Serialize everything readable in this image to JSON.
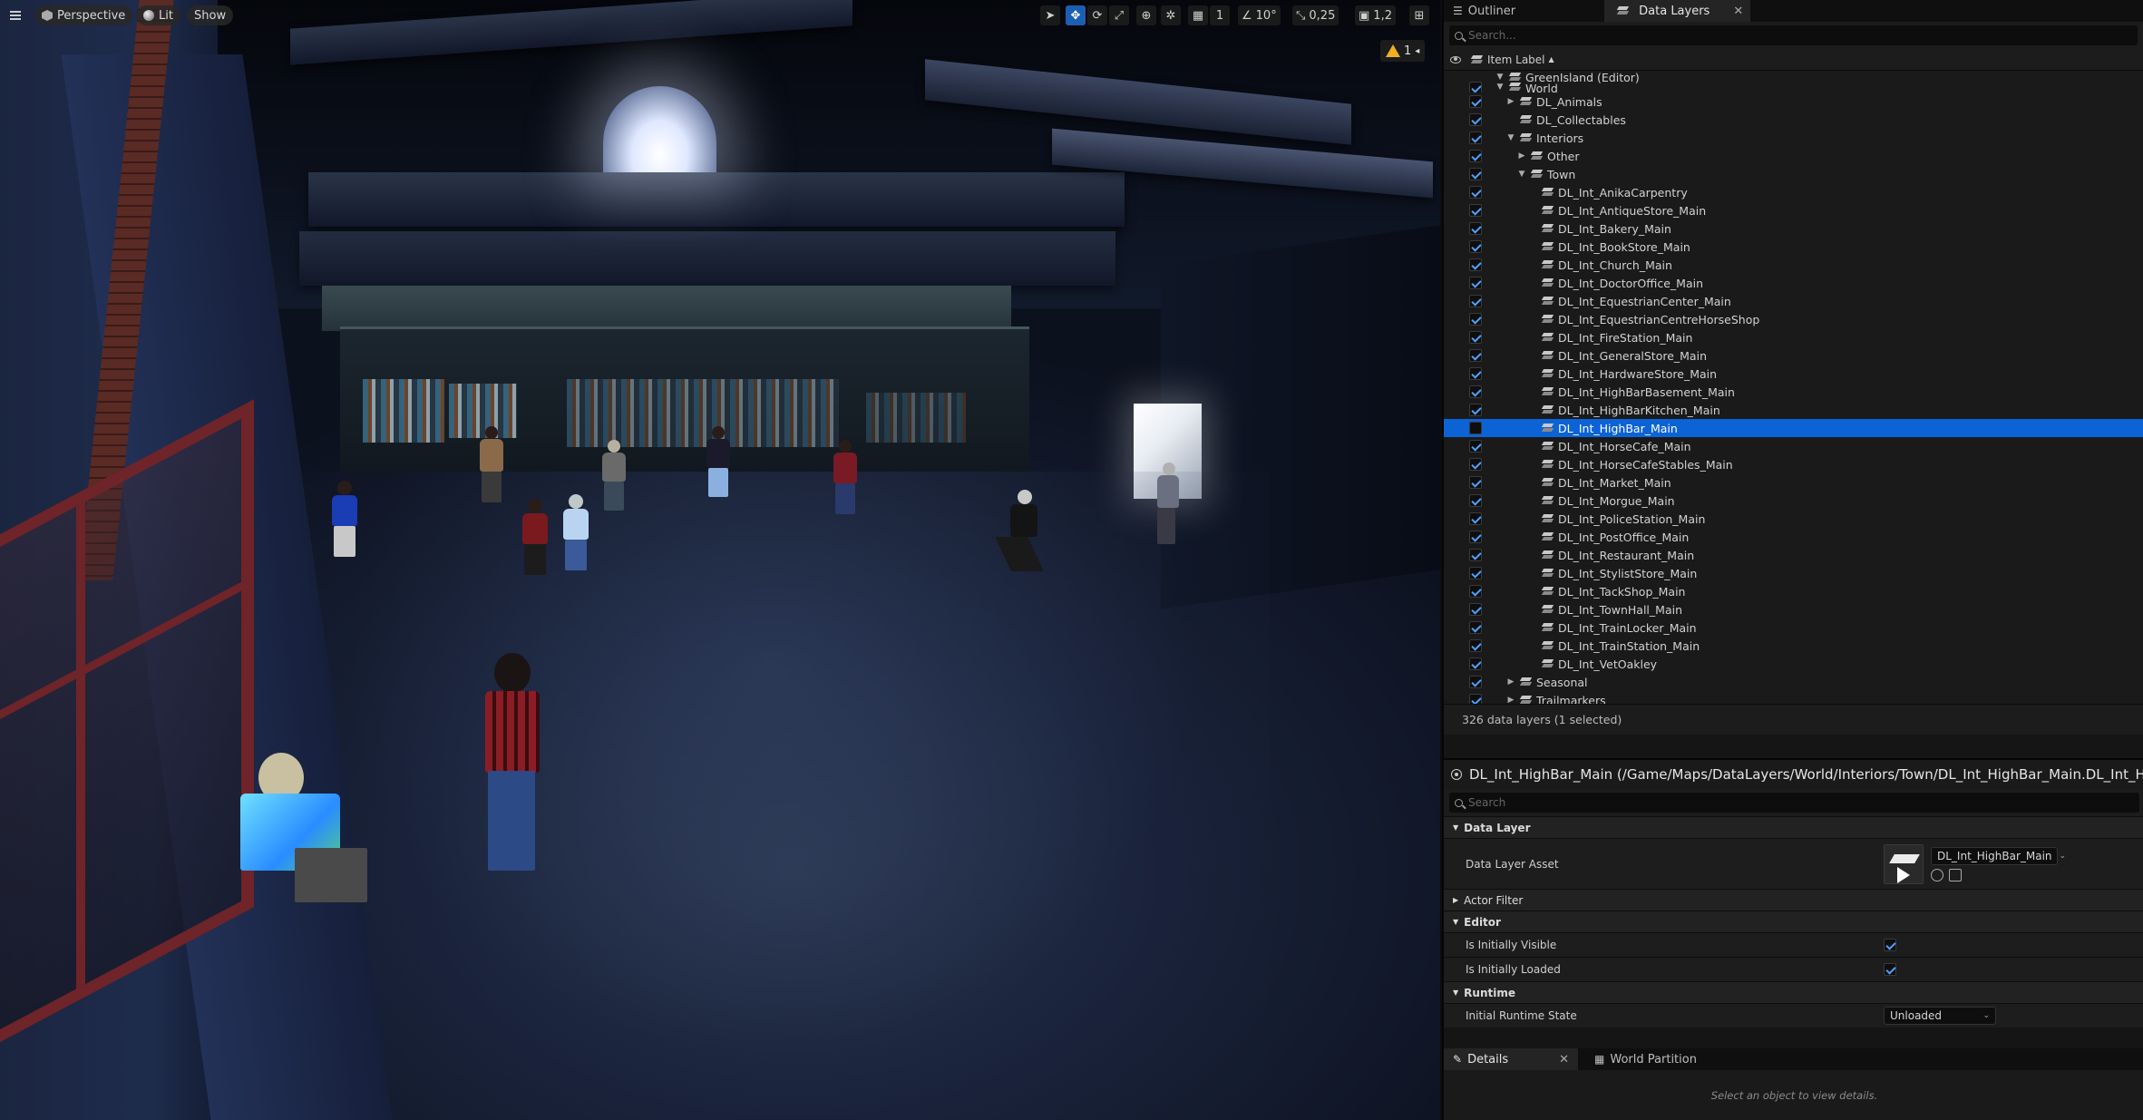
{
  "viewport": {
    "menu_icon": "hamburger-icon",
    "perspective_label": "Perspective",
    "lit_label": "Lit",
    "show_label": "Show",
    "grid_snap_value": "1",
    "rotation_snap_value": "10°",
    "scale_snap_value": "0,25",
    "camera_speed_value": "1,2",
    "warning_count": "1"
  },
  "outliner_panel": {
    "tabs": [
      {
        "label": "Outliner",
        "active": false
      },
      {
        "label": "Data Layers",
        "active": true
      }
    ],
    "close_glyph": "✕",
    "search_placeholder": "Search...",
    "column_label": "Item Label",
    "sort_glyph": "▲",
    "tree": [
      {
        "label": "GreenIsland (Editor)",
        "indent": 2,
        "expander": "▼",
        "check": "none",
        "icon": "world-icon"
      },
      {
        "label": "World",
        "indent": 2,
        "expander": "▼",
        "check": "on",
        "icon": "data-layer-icon"
      },
      {
        "label": "DL_Animals",
        "indent": 3,
        "expander": "▶",
        "check": "on",
        "icon": "data-layer-icon"
      },
      {
        "label": "DL_Collectables",
        "indent": 3,
        "expander": "",
        "check": "on",
        "icon": "data-layer-icon"
      },
      {
        "label": "Interiors",
        "indent": 3,
        "expander": "▼",
        "check": "on",
        "icon": "data-layer-icon"
      },
      {
        "label": "Other",
        "indent": 4,
        "expander": "▶",
        "check": "on",
        "icon": "data-layer-icon"
      },
      {
        "label": "Town",
        "indent": 4,
        "expander": "▼",
        "check": "on",
        "icon": "data-layer-icon"
      },
      {
        "label": "DL_Int_AnikaCarpentry",
        "indent": 5,
        "expander": "",
        "check": "on",
        "icon": "data-layer-icon"
      },
      {
        "label": "DL_Int_AntiqueStore_Main",
        "indent": 5,
        "expander": "",
        "check": "on",
        "icon": "data-layer-icon"
      },
      {
        "label": "DL_Int_Bakery_Main",
        "indent": 5,
        "expander": "",
        "check": "on",
        "icon": "data-layer-icon"
      },
      {
        "label": "DL_Int_BookStore_Main",
        "indent": 5,
        "expander": "",
        "check": "on",
        "icon": "data-layer-icon"
      },
      {
        "label": "DL_Int_Church_Main",
        "indent": 5,
        "expander": "",
        "check": "on",
        "icon": "data-layer-icon"
      },
      {
        "label": "DL_Int_DoctorOffice_Main",
        "indent": 5,
        "expander": "",
        "check": "on",
        "icon": "data-layer-icon"
      },
      {
        "label": "DL_Int_EquestrianCenter_Main",
        "indent": 5,
        "expander": "",
        "check": "on",
        "icon": "data-layer-icon"
      },
      {
        "label": "DL_Int_EquestrianCentreHorseShop",
        "indent": 5,
        "expander": "",
        "check": "on",
        "icon": "data-layer-icon"
      },
      {
        "label": "DL_Int_FireStation_Main",
        "indent": 5,
        "expander": "",
        "check": "on",
        "icon": "data-layer-icon"
      },
      {
        "label": "DL_Int_GeneralStore_Main",
        "indent": 5,
        "expander": "",
        "check": "on",
        "icon": "data-layer-icon"
      },
      {
        "label": "DL_Int_HardwareStore_Main",
        "indent": 5,
        "expander": "",
        "check": "on",
        "icon": "data-layer-icon"
      },
      {
        "label": "DL_Int_HighBarBasement_Main",
        "indent": 5,
        "expander": "",
        "check": "on",
        "icon": "data-layer-icon"
      },
      {
        "label": "DL_Int_HighBarKitchen_Main",
        "indent": 5,
        "expander": "",
        "check": "on",
        "icon": "data-layer-icon"
      },
      {
        "label": "DL_Int_HighBar_Main",
        "indent": 5,
        "expander": "",
        "check": "off",
        "icon": "data-layer-icon",
        "selected": true
      },
      {
        "label": "DL_Int_HorseCafe_Main",
        "indent": 5,
        "expander": "",
        "check": "on",
        "icon": "data-layer-icon"
      },
      {
        "label": "DL_Int_HorseCafeStables_Main",
        "indent": 5,
        "expander": "",
        "check": "on",
        "icon": "data-layer-icon"
      },
      {
        "label": "DL_Int_Market_Main",
        "indent": 5,
        "expander": "",
        "check": "on",
        "icon": "data-layer-icon"
      },
      {
        "label": "DL_Int_Morgue_Main",
        "indent": 5,
        "expander": "",
        "check": "on",
        "icon": "data-layer-icon"
      },
      {
        "label": "DL_Int_PoliceStation_Main",
        "indent": 5,
        "expander": "",
        "check": "on",
        "icon": "data-layer-icon"
      },
      {
        "label": "DL_Int_PostOffice_Main",
        "indent": 5,
        "expander": "",
        "check": "on",
        "icon": "data-layer-icon"
      },
      {
        "label": "DL_Int_Restaurant_Main",
        "indent": 5,
        "expander": "",
        "check": "on",
        "icon": "data-layer-icon"
      },
      {
        "label": "DL_Int_StylistStore_Main",
        "indent": 5,
        "expander": "",
        "check": "on",
        "icon": "data-layer-icon"
      },
      {
        "label": "DL_Int_TackShop_Main",
        "indent": 5,
        "expander": "",
        "check": "on",
        "icon": "data-layer-icon"
      },
      {
        "label": "DL_Int_TownHall_Main",
        "indent": 5,
        "expander": "",
        "check": "on",
        "icon": "data-layer-icon"
      },
      {
        "label": "DL_Int_TrainLocker_Main",
        "indent": 5,
        "expander": "",
        "check": "on",
        "icon": "data-layer-icon"
      },
      {
        "label": "DL_Int_TrainStation_Main",
        "indent": 5,
        "expander": "",
        "check": "on",
        "icon": "data-layer-icon"
      },
      {
        "label": "DL_Int_VetOakley",
        "indent": 5,
        "expander": "",
        "check": "on",
        "icon": "data-layer-icon"
      },
      {
        "label": "Seasonal",
        "indent": 3,
        "expander": "▶",
        "check": "on",
        "icon": "data-layer-icon"
      },
      {
        "label": "Trailmarkers",
        "indent": 3,
        "expander": "▶",
        "check": "on",
        "icon": "data-layer-icon"
      }
    ],
    "status_text": "326 data layers (1 selected)"
  },
  "details": {
    "title": "DL_Int_HighBar_Main (/Game/Maps/DataLayers/World/Interiors/Town/DL_Int_HighBar_Main.DL_Int_HighBar_Main)",
    "search_placeholder": "Search",
    "category_data_layer": "Data Layer",
    "prop_data_layer_asset": "Data Layer Asset",
    "asset_value": "DL_Int_HighBar_Main",
    "category_actor_filter": "Actor Filter",
    "category_editor": "Editor",
    "prop_initially_visible": "Is Initially Visible",
    "prop_initially_loaded": "Is Initially Loaded",
    "category_runtime": "Runtime",
    "prop_initial_runtime_state": "Initial Runtime State",
    "runtime_state_value": "Unloaded",
    "expanded_glyph": "▼",
    "collapsed_glyph": "▶",
    "chevron_glyph": "⌄"
  },
  "bottom_panel": {
    "tabs": [
      {
        "label": "Details",
        "active": true
      },
      {
        "label": "World Partition",
        "active": false
      }
    ],
    "close_glyph": "✕",
    "empty_message": "Select an object to view details."
  },
  "colors": {
    "selection_blue": "#0b63d6",
    "checkbox_blue": "#4aa3ff",
    "panel_bg": "#151515",
    "active_tool": "#1a5fb4"
  }
}
